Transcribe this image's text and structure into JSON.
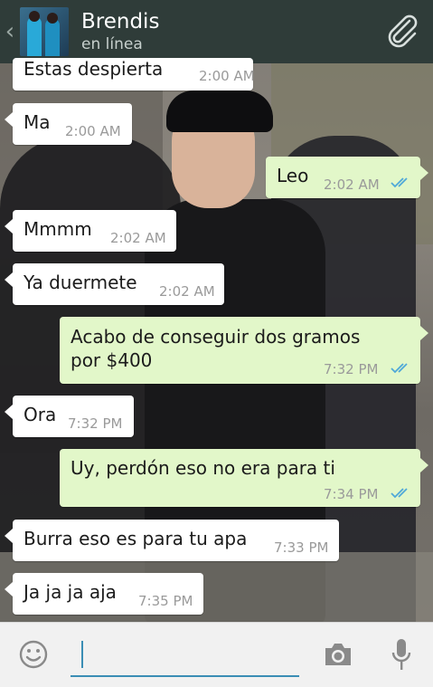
{
  "header": {
    "contact_name": "Brendis",
    "status": "en línea"
  },
  "messages": [
    {
      "dir": "in",
      "text": "Estas despierta",
      "time": "2:00 AM",
      "read": false
    },
    {
      "dir": "in",
      "text": "Ma",
      "time": "2:00 AM",
      "read": false
    },
    {
      "dir": "out",
      "text": "Leo",
      "time": "2:02 AM",
      "read": true
    },
    {
      "dir": "in",
      "text": "Mmmm",
      "time": "2:02 AM",
      "read": false
    },
    {
      "dir": "in",
      "text": "Ya duermete",
      "time": "2:02 AM",
      "read": false
    },
    {
      "dir": "out",
      "text": "Acabo de conseguir dos gramos",
      "text2": "por $400",
      "time": "7:32 PM",
      "read": true
    },
    {
      "dir": "in",
      "text": "Ora",
      "time": "7:32 PM",
      "read": false
    },
    {
      "dir": "out",
      "text": "Uy, perdón eso no era para ti",
      "time": "7:34 PM",
      "read": true
    },
    {
      "dir": "in",
      "text": "Burra eso es para tu apa",
      "time": "7:33 PM",
      "read": false
    },
    {
      "dir": "in",
      "text": "Ja ja ja aja",
      "time": "7:35 PM",
      "read": false
    }
  ],
  "input": {
    "value": ""
  },
  "icons": {
    "back": "chevron-left-icon",
    "attach": "paperclip-icon",
    "emoji": "smiley-icon",
    "camera": "camera-icon",
    "mic": "microphone-icon",
    "read_receipt": "double-check-icon"
  },
  "colors": {
    "header_bg": "#2f3c39",
    "outgoing_bubble": "#e2f7c9",
    "incoming_bubble": "#ffffff",
    "read_tick": "#4fa8d8",
    "input_accent": "#3b8eb5"
  }
}
